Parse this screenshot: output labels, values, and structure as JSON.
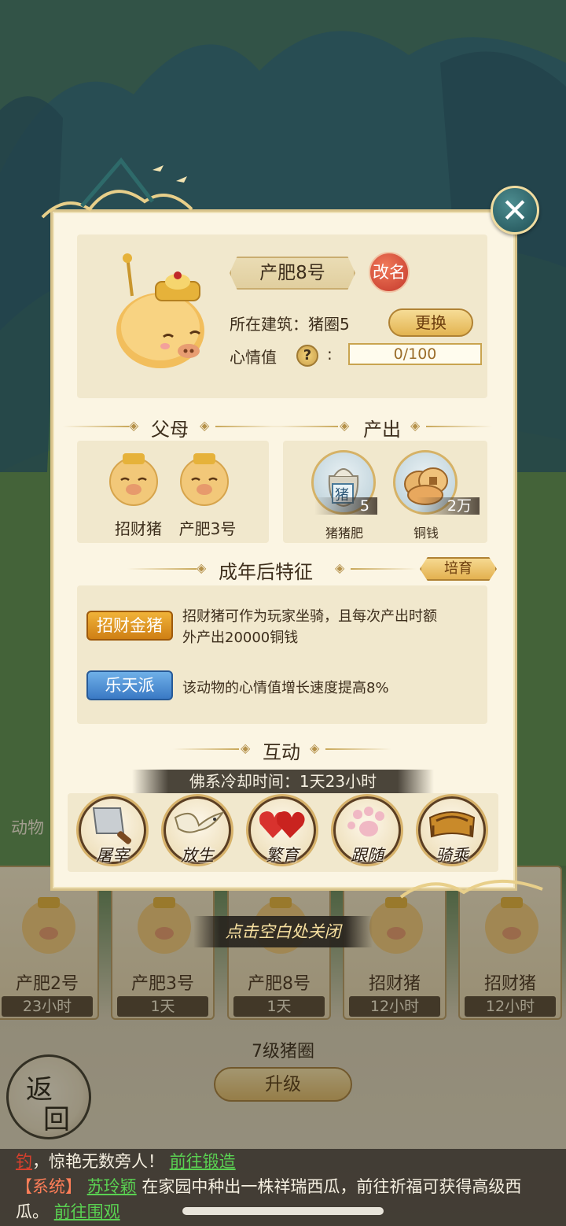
{
  "animal": {
    "name": "产肥8号",
    "rename_label": "改名",
    "building_label": "所在建筑：",
    "building_value": "猪圈5",
    "swap_label": "更换",
    "mood_label": "心情值",
    "help_glyph": "?",
    "mood_colon": ":",
    "mood_value": "0/100",
    "mood_fraction": 0.0
  },
  "parents": {
    "title": "父母",
    "items": [
      {
        "name": "招财猪"
      },
      {
        "name": "产肥3号"
      }
    ]
  },
  "output": {
    "title": "产出",
    "items": [
      {
        "label": "猪猪肥",
        "qty": "5",
        "icon": "manure-bag-icon",
        "badge": "猪"
      },
      {
        "label": "铜钱",
        "qty": "2万",
        "icon": "copper-coins-icon"
      }
    ]
  },
  "traits": {
    "title": "成年后特征",
    "breed_label": "培育",
    "items": [
      {
        "tag": "招财金猪",
        "style": "gold",
        "desc_1": "招财猪可作为玩家坐骑，且每次产出时额",
        "desc_2": "外产出20000铜钱"
      },
      {
        "tag": "乐天派",
        "style": "blue",
        "desc_1": "该动物的心情值增长速度提高8%"
      }
    ]
  },
  "interact": {
    "title": "互动",
    "cooldown": "佛系冷却时间：1天23小时",
    "actions": [
      {
        "label": "屠宰",
        "icon": "cleaver-icon"
      },
      {
        "label": "放生",
        "icon": "bird-icon"
      },
      {
        "label": "繁育",
        "icon": "hearts-icon"
      },
      {
        "label": "跟随",
        "icon": "paw-icon"
      },
      {
        "label": "骑乘",
        "icon": "saddle-icon"
      }
    ]
  },
  "close_tip": "点击空白处关闭",
  "background": {
    "animals_label": "动物",
    "pen_cards": [
      {
        "name": "产肥2号",
        "time": "23小时"
      },
      {
        "name": "产肥3号",
        "time": "1天"
      },
      {
        "name": "产肥8号",
        "time": "1天"
      },
      {
        "name": "招财猪",
        "time": "12小时"
      },
      {
        "name": "招财猪",
        "time": "12小时"
      }
    ],
    "pen_level": "7级猪圈",
    "upgrade_label": "升级",
    "return_char_1": "返",
    "return_char_2": "回"
  },
  "chat": {
    "line1_link1": "钓",
    "line1_text": "，惊艳无数旁人！",
    "line1_link2": "前往锻造",
    "line2_tag": "【系统】",
    "line2_player": "苏玲颖",
    "line2_text": "在家园中种出一株祥瑞西瓜，前往祈福可获得高级西",
    "line3_text": "瓜。",
    "line3_link": "前往围观"
  },
  "colors": {
    "panel_bg": "#fbf5e3",
    "gold_accent": "#d6b266",
    "trait_gold": "#cf7f14",
    "trait_blue": "#3a79c4",
    "chat_link_green": "#5ad152",
    "chat_link_red": "#d8402d"
  }
}
